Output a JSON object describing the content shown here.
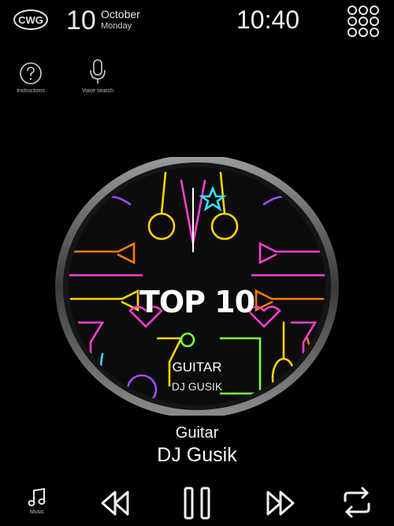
{
  "header": {
    "logo_text": "CWG",
    "day": "10",
    "month": "October",
    "weekday": "Monday",
    "time": "10:40",
    "apps_icon": "apps-grid-icon"
  },
  "quick_actions": [
    {
      "label": "Instructions",
      "icon": "help-circle-icon"
    },
    {
      "label": "Voice search",
      "icon": "microphone-icon"
    }
  ],
  "album": {
    "cover_title": "TOP 10",
    "genre": "GUITAR",
    "artist": "DJ GUSIK"
  },
  "now_playing": {
    "title": "Guitar",
    "artist": "DJ Gusik"
  },
  "controls": {
    "music_label": "Music",
    "icons": [
      "music-note-icon",
      "rewind-icon",
      "pause-icon",
      "fast-forward-icon",
      "repeat-icon"
    ]
  },
  "colors": {
    "background": "#000000",
    "neon": [
      "#ff3fd2",
      "#ffd400",
      "#34e0ff",
      "#ff7a00",
      "#7dff3a",
      "#a14bff"
    ]
  }
}
